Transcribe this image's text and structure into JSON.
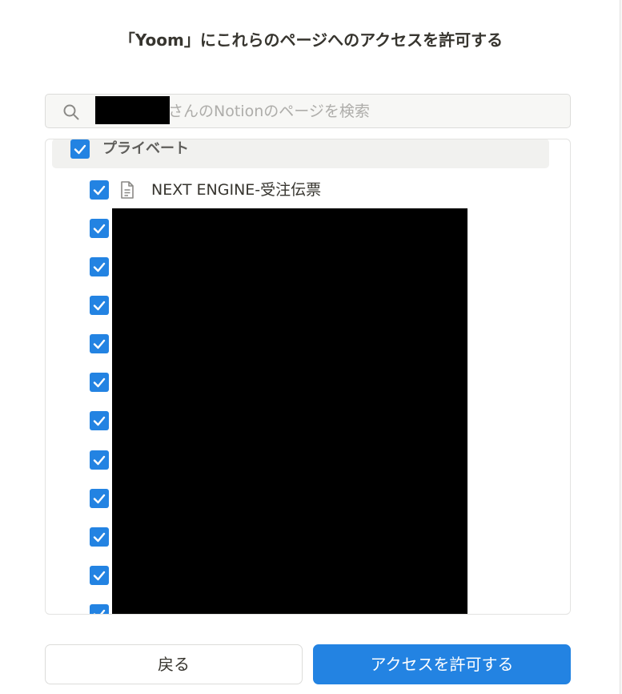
{
  "dialog": {
    "title_before": "「",
    "title_app": "Yoom",
    "title_after": "」にこれらのページへのアクセスを許可する"
  },
  "search": {
    "placeholder": "さんのNotionのページを検索",
    "icon": "search-icon"
  },
  "workspace": {
    "label": "プライベート",
    "checked": true
  },
  "pages": [
    {
      "title": "NEXT ENGINE-受注伝票",
      "icon": "document-icon",
      "checked": true
    },
    {
      "title": "",
      "checked": true
    },
    {
      "title": "",
      "checked": true
    },
    {
      "title": "",
      "checked": true
    },
    {
      "title": "",
      "checked": true
    },
    {
      "title": "",
      "checked": true
    },
    {
      "title": "",
      "checked": true
    },
    {
      "title": "",
      "checked": true
    },
    {
      "title": "",
      "checked": true
    },
    {
      "title": "",
      "checked": true
    },
    {
      "title": "",
      "checked": true
    },
    {
      "title": "",
      "checked": true
    }
  ],
  "buttons": {
    "back_label": "戻る",
    "allow_label": "アクセスを許可する"
  },
  "colors": {
    "accent": "#2383e2",
    "text": "#37352f",
    "placeholder": "#aeadaa",
    "workspace_row_bg": "#f1f1ef"
  }
}
